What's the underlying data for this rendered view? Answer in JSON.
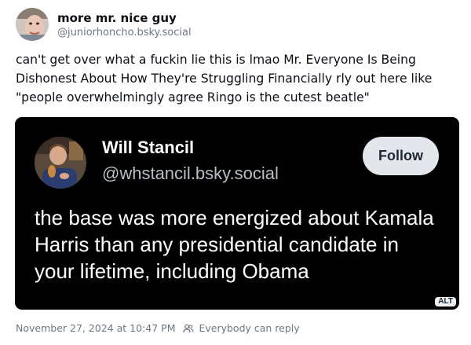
{
  "post": {
    "author": {
      "display_name": "more mr. nice guy",
      "handle": "@juniorhoncho.bsky.social",
      "avatar_icon": "user-avatar"
    },
    "text": "can't get over what a fuckin lie this is lmao Mr. Everyone Is Being Dishonest About How They're Struggling Financially rly out here like \"people overwhelmingly agree Ringo is the cutest beatle\"",
    "embedded_image": {
      "author_name": "Will Stancil",
      "author_handle": "@whstancil.bsky.social",
      "follow_label": "Follow",
      "text": "the base was more energized about Kamala Harris than any presidential candidate in your lifetime, including Obama",
      "alt_badge": "ALT",
      "background_color": "#000000"
    },
    "footer": {
      "timestamp": "November 27, 2024 at 10:47 PM",
      "reply_setting": "Everybody can reply",
      "reply_icon": "people-icon"
    }
  }
}
